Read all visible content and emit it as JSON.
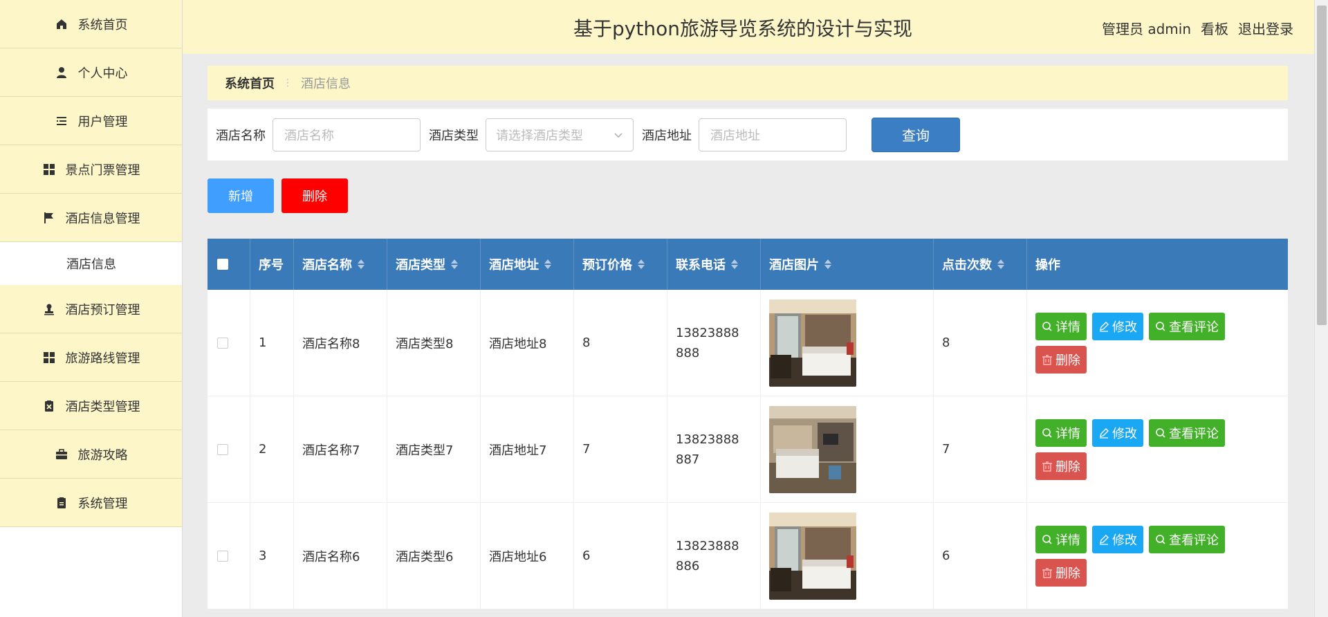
{
  "header": {
    "title": "基于python旅游导览系统的设计与实现",
    "user": "管理员 admin",
    "board": "看板",
    "logout": "退出登录"
  },
  "sidebar": {
    "items": [
      {
        "label": "系统首页",
        "icon": "home-icon"
      },
      {
        "label": "个人中心",
        "icon": "user-icon"
      },
      {
        "label": "用户管理",
        "icon": "list-icon"
      },
      {
        "label": "景点门票管理",
        "icon": "grid-icon"
      },
      {
        "label": "酒店信息管理",
        "icon": "flag-icon"
      },
      {
        "label": "酒店信息",
        "icon": ""
      },
      {
        "label": "酒店预订管理",
        "icon": "stamp-icon"
      },
      {
        "label": "旅游路线管理",
        "icon": "grid-icon"
      },
      {
        "label": "酒店类型管理",
        "icon": "clipboard-x-icon"
      },
      {
        "label": "旅游攻略",
        "icon": "briefcase-icon"
      },
      {
        "label": "系统管理",
        "icon": "clipboard-icon"
      }
    ]
  },
  "breadcrumb": {
    "home": "系统首页",
    "separator": "⋮",
    "current": "酒店信息"
  },
  "search": {
    "name_label": "酒店名称",
    "name_placeholder": "酒店名称",
    "type_label": "酒店类型",
    "type_placeholder": "请选择酒店类型",
    "address_label": "酒店地址",
    "address_placeholder": "酒店地址",
    "query_button": "查询"
  },
  "actions": {
    "add": "新增",
    "delete": "删除"
  },
  "table": {
    "headers": [
      "序号",
      "酒店名称",
      "酒店类型",
      "酒店地址",
      "预订价格",
      "联系电话",
      "酒店图片",
      "点击次数",
      "操作"
    ],
    "rows": [
      {
        "index": "1",
        "name": "酒店名称8",
        "type": "酒店类型8",
        "address": "酒店地址8",
        "price": "8",
        "phone": "13823888888",
        "clicks": "8"
      },
      {
        "index": "2",
        "name": "酒店名称7",
        "type": "酒店类型7",
        "address": "酒店地址7",
        "price": "7",
        "phone": "13823888887",
        "clicks": "7"
      },
      {
        "index": "3",
        "name": "酒店名称6",
        "type": "酒店类型6",
        "address": "酒店地址6",
        "price": "6",
        "phone": "13823888886",
        "clicks": "6"
      }
    ],
    "row_actions": {
      "detail": "详情",
      "edit": "修改",
      "reviews": "查看评论",
      "delete": "删除"
    }
  },
  "colors": {
    "sidebar_bg": "#fdf6c9",
    "header_bg": "#fdf6c9",
    "table_header": "#3a7ab8",
    "query_button": "#3c7ec4",
    "add_button": "#409eff",
    "delete_button": "#ff0000",
    "green_button": "#43b02a",
    "blue_button": "#1aa7f3",
    "red_button": "#d9534f"
  }
}
